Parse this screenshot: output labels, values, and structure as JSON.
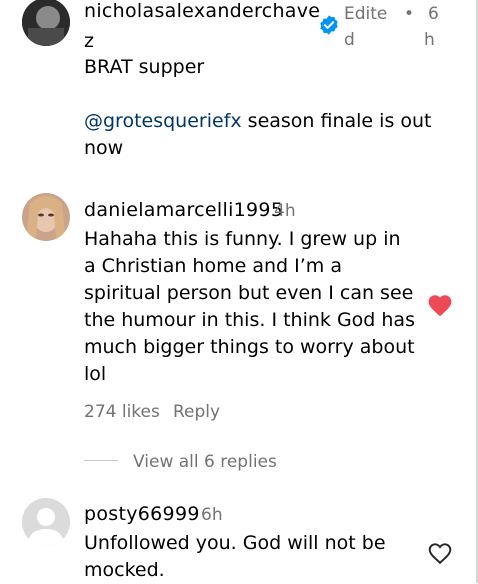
{
  "comments": [
    {
      "username_line1": "nicholasalexanderchave",
      "username_line2": "z",
      "verified": true,
      "edited_line1": "Edite",
      "edited_line2": "d",
      "dot": "•",
      "time_line1": "6",
      "time_line2": "h",
      "text_line1": "BRAT supper",
      "mention": "@grotesqueriefx",
      "text_line2_rest": " season finale is out",
      "text_line3": "now"
    },
    {
      "username": "danielamarcelli1995",
      "time": "4h",
      "text": "Hahaha this is funny. I grew up in a Christian home and I’m a spiritual person but even I can see the humour in this. I think God has much bigger things to worry about lol",
      "likes": "274 likes",
      "reply": "Reply",
      "liked": true,
      "view_replies": "View all 6 replies"
    },
    {
      "username": "posty66999",
      "time": "6h",
      "text": "Unfollowed you. God will not be mocked.",
      "liked": false
    }
  ],
  "colors": {
    "like_active": "#ed4956",
    "verified": "#0095f6",
    "secondary_text": "#737373",
    "mention": "#00376b"
  }
}
